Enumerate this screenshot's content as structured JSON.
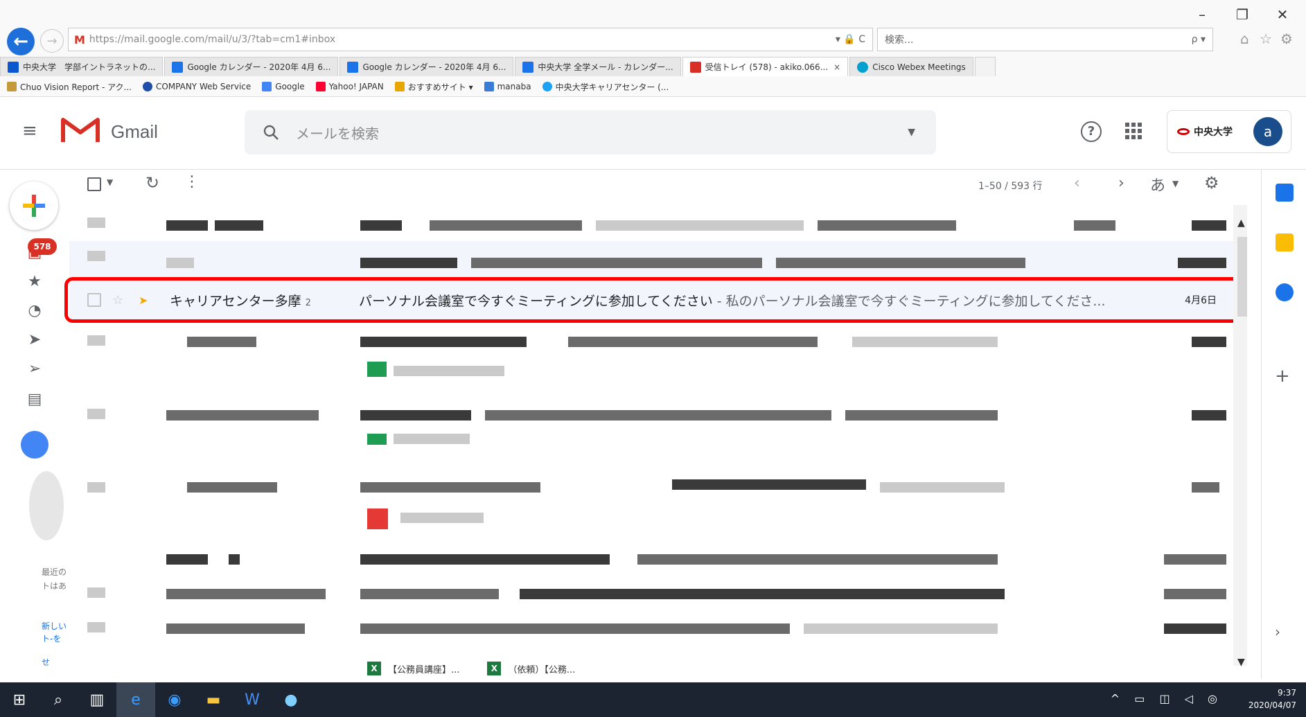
{
  "window_controls": {
    "minimize": "–",
    "maximize": "❐",
    "close": "✕"
  },
  "browser": {
    "url": "https://mail.google.com/mail/u/3/?tab=cm1#inbox",
    "url_controls": "▾ 🔒 C",
    "search_placeholder": "検索...",
    "search_glyph": "ρ ▾",
    "tabs": [
      {
        "label": "中央大学　学部イントラネットの...",
        "color": "#0b57d0"
      },
      {
        "label": "Google カレンダー - 2020年 4月 6...",
        "color": "#1a73e8"
      },
      {
        "label": "Google カレンダー - 2020年 4月 6...",
        "color": "#1a73e8"
      },
      {
        "label": "中央大学 全学メール - カレンダー...",
        "color": "#1a73e8"
      },
      {
        "label": "受信トレイ (578) - akiko.066...",
        "color": "#d93025",
        "active": true
      },
      {
        "label": "Cisco Webex Meetings",
        "color": "#00a0d1"
      }
    ],
    "favorites": [
      {
        "label": "Chuo Vision Report - アク...",
        "color": "#c49a3a"
      },
      {
        "label": "COMPANY Web Service",
        "color": "#1f4fa8"
      },
      {
        "label": "Google",
        "color": "#4285f4"
      },
      {
        "label": "Yahoo! JAPAN",
        "color": "#ff0033"
      },
      {
        "label": "おすすめサイト ▾",
        "color": "#e8a600"
      },
      {
        "label": "manaba",
        "color": "#3a7bd5"
      },
      {
        "label": "中央大学キャリアセンター (...",
        "color": "#1da1f2"
      }
    ]
  },
  "gmail": {
    "app_name": "Gmail",
    "search_placeholder": "メールを検索",
    "account_initial": "a",
    "org_name": "中央大学",
    "toolbar": {
      "count": "1–50 / 593 行",
      "lang_label": "あ"
    },
    "inbox_badge": "578",
    "rail_text": {
      "recent_1": "最近の",
      "recent_2": "トはあ",
      "new_1": "新しい",
      "new_2": "ト-を",
      "new_3": "せ"
    },
    "highlighted_email": {
      "sender": "キャリアセンター多摩",
      "thread_count": "2",
      "subject": "パーソナル会議室で今すぐミーティングに参加してください",
      "snippet": " - 私のパーソナル会議室で今すぐミーティングに参加してくださ...",
      "date": "4月6日"
    },
    "attachments": [
      {
        "label": "【公務員講座】..."
      },
      {
        "label": "（依頼）【公務..."
      }
    ]
  },
  "taskbar": {
    "time": "9:37",
    "date": "2020/04/07"
  },
  "colors": {
    "gmail_red": "#d93025",
    "highlight_border": "#ff0000",
    "taskbar": "#1b2430",
    "accent_blue": "#1a73e8"
  }
}
